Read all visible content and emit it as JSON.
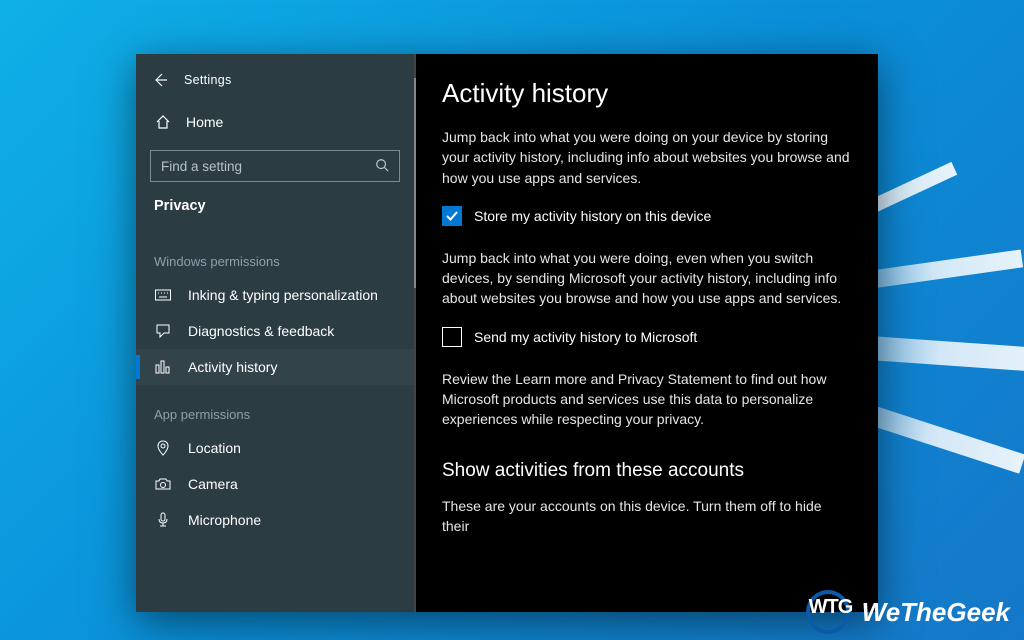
{
  "titlebar": {
    "title": "Settings"
  },
  "sidebar": {
    "home": "Home",
    "search_placeholder": "Find a setting",
    "category": "Privacy",
    "group1_label": "Windows permissions",
    "group1": {
      "inking": "Inking & typing personalization",
      "diagnostics": "Diagnostics & feedback",
      "activity": "Activity history"
    },
    "group2_label": "App permissions",
    "group2": {
      "location": "Location",
      "camera": "Camera",
      "microphone": "Microphone"
    }
  },
  "content": {
    "heading": "Activity history",
    "para1": "Jump back into what you were doing on your device by storing your activity history, including info about websites you browse and how you use apps and services.",
    "checkbox1": {
      "label": "Store my activity history on this device",
      "checked": true
    },
    "para2": "Jump back into what you were doing, even when you switch devices, by sending Microsoft your activity history, including info about websites you browse and how you use apps and services.",
    "checkbox2": {
      "label": "Send my activity history to Microsoft",
      "checked": false
    },
    "para3": "Review the Learn more and Privacy Statement to find out how Microsoft products and services use this data to personalize experiences while respecting your privacy.",
    "heading2": "Show activities from these accounts",
    "para4": "These are your accounts on this device. Turn them off to hide their"
  },
  "watermark": {
    "badge": "WTG",
    "text": "WeTheGeek"
  }
}
